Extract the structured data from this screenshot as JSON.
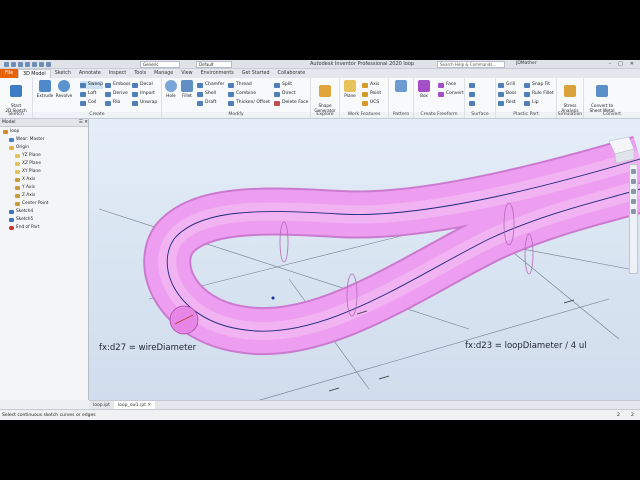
{
  "window": {
    "title": "Autodesk Inventor Professional 2020   loop",
    "appearance": "Generic",
    "style": "Default",
    "search_placeholder": "Search Help & Commands...",
    "user": "JDMather"
  },
  "tabs": [
    "File",
    "3D Model",
    "Sketch",
    "Annotate",
    "Inspect",
    "Tools",
    "Manage",
    "View",
    "Environments",
    "Get Started",
    "Collaborate"
  ],
  "ribbon": {
    "sketch_panel": {
      "label": "Sketch",
      "start": "Start\n2D Sketch"
    },
    "create_panel": {
      "label": "Create",
      "extrude": "Extrude",
      "revolve": "Revolve",
      "sweep": "Sweep",
      "loft": "Loft",
      "coil": "Coil",
      "emboss": "Emboss",
      "derive": "Derive",
      "rib": "Rib",
      "decal": "Decal",
      "import": "Import",
      "unwrap": "Unwrap"
    },
    "modify_panel": {
      "label": "Modify",
      "hole": "Hole",
      "fillet": "Fillet",
      "chamfer": "Chamfer",
      "shell": "Shell",
      "draft": "Draft",
      "thread": "Thread",
      "combine": "Combine",
      "thicken": "Thicken/ Offset",
      "split": "Split",
      "direct": "Direct",
      "delete_face": "Delete Face"
    },
    "explore_panel": {
      "label": "Explore",
      "shape_generator": "Shape\nGenerator"
    },
    "workfeatures_panel": {
      "label": "Work Features",
      "plane": "Plane",
      "axis": "Axis",
      "point": "Point",
      "ucs": "UCS"
    },
    "pattern_panel": {
      "label": "Pattern"
    },
    "freeform_panel": {
      "label": "Create Freeform",
      "box": "Box",
      "face": "Face",
      "convert": "Convert"
    },
    "surface_panel": {
      "label": "Surface"
    },
    "plastic_panel": {
      "label": "Plastic Part",
      "grill": "Grill",
      "boss": "Boss",
      "rest": "Rest",
      "snap_fit": "Snap Fit",
      "rule_fillet": "Rule Fillet",
      "lip": "Lip"
    },
    "simulation_panel": {
      "label": "Simulation",
      "stress": "Stress\nAnalysis"
    },
    "convert_panel": {
      "label": "Convert",
      "sheet_metal": "Convert to\nSheet Metal"
    }
  },
  "browser": {
    "header": "Model",
    "items": [
      {
        "label": "loop",
        "icon": "part-icon",
        "indent": 0
      },
      {
        "label": "Wear: Master",
        "icon": "view-icon",
        "indent": 1
      },
      {
        "label": "Origin",
        "icon": "folder-icon",
        "indent": 1
      },
      {
        "label": "YZ Plane",
        "icon": "plane-icon",
        "indent": 2
      },
      {
        "label": "XZ Plane",
        "icon": "plane-icon",
        "indent": 2
      },
      {
        "label": "XY Plane",
        "icon": "plane-icon",
        "indent": 2
      },
      {
        "label": "X Axis",
        "icon": "axis-icon",
        "indent": 2
      },
      {
        "label": "Y Axis",
        "icon": "axis-icon",
        "indent": 2
      },
      {
        "label": "Z Axis",
        "icon": "axis-icon",
        "indent": 2
      },
      {
        "label": "Center Point",
        "icon": "point-icon",
        "indent": 2
      },
      {
        "label": "Sketch4",
        "icon": "sketch-icon",
        "indent": 1
      },
      {
        "label": "Sketch5",
        "icon": "sketch-icon",
        "indent": 1
      },
      {
        "label": "End of Part",
        "icon": "end-icon",
        "indent": 1
      }
    ]
  },
  "viewport": {
    "annotation_wire": "fx:d27 = wireDiameter",
    "annotation_loop": "fx:d23 = loopDiameter / 4 ul",
    "tube_color": "#ee9ef0"
  },
  "document_tabs": [
    "loop.ipt",
    "loop_sw1.ipt"
  ],
  "status": {
    "message": "Select continuous sketch curves or edges",
    "count1": "2",
    "count2": "2"
  }
}
